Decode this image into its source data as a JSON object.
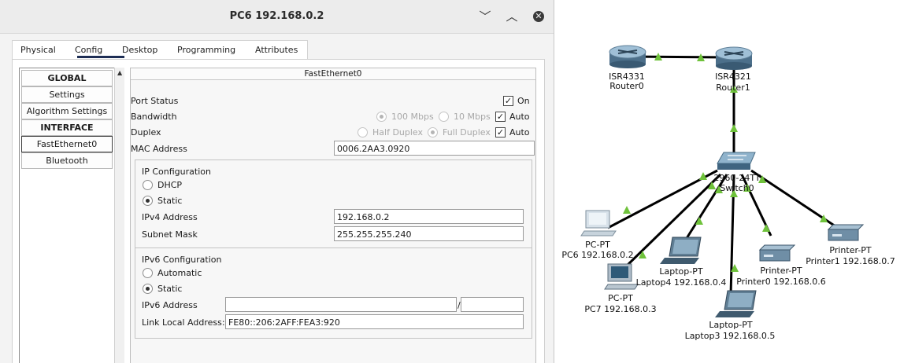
{
  "window": {
    "title": "PC6 192.168.0.2",
    "controls": {
      "minimize": "﹀",
      "maximize": "︿",
      "close": "✕"
    }
  },
  "tabs": [
    {
      "label": "Physical"
    },
    {
      "label": "Config",
      "active": true
    },
    {
      "label": "Desktop"
    },
    {
      "label": "Programming"
    },
    {
      "label": "Attributes"
    }
  ],
  "sidebar": {
    "global_header": "GLOBAL",
    "settings": "Settings",
    "algorithm_settings": "Algorithm Settings",
    "interface_header": "INTERFACE",
    "fastethernet0": "FastEthernet0",
    "bluetooth": "Bluetooth"
  },
  "panel": {
    "title": "FastEthernet0",
    "port_status": {
      "label": "Port Status",
      "on_label": "On",
      "checked": true
    },
    "bandwidth": {
      "label": "Bandwidth",
      "opt_100": "100 Mbps",
      "opt_10": "10 Mbps",
      "auto_label": "Auto",
      "auto": true
    },
    "duplex": {
      "label": "Duplex",
      "half": "Half Duplex",
      "full": "Full Duplex",
      "auto_label": "Auto",
      "auto": true
    },
    "mac": {
      "label": "MAC Address",
      "value": "0006.2AA3.0920"
    },
    "ip_config": {
      "title": "IP Configuration",
      "dhcp": "DHCP",
      "static": "Static",
      "selected": "static",
      "ipv4_label": "IPv4 Address",
      "ipv4_value": "192.168.0.2",
      "mask_label": "Subnet Mask",
      "mask_value": "255.255.255.240"
    },
    "ipv6_config": {
      "title": "IPv6 Configuration",
      "automatic": "Automatic",
      "static": "Static",
      "selected": "static",
      "ipv6_label": "IPv6 Address",
      "ipv6_value": "",
      "prefix_sep": "/",
      "prefix_value": "",
      "link_local_label": "Link Local Address:",
      "link_local_value": "FE80::206:2AFF:FEA3:920"
    }
  },
  "topology": {
    "colors": {
      "link": "#000000",
      "link_status": "#6fc23b"
    },
    "router0": {
      "model": "ISR4331",
      "name": "Router0"
    },
    "router1": {
      "model": "ISR4321",
      "name": "Router1"
    },
    "switch": {
      "model": "2960-24TT",
      "name": "Switch0"
    },
    "pc6": {
      "type": "PC-PT",
      "name": "PC6 192.168.0.2"
    },
    "pc7": {
      "type": "PC-PT",
      "name": "PC7 192.168.0.3"
    },
    "laptop4": {
      "type": "Laptop-PT",
      "name": "Laptop4 192.168.0.4"
    },
    "laptop3": {
      "type": "Laptop-PT",
      "name": "Laptop3 192.168.0.5"
    },
    "printer0": {
      "type": "Printer-PT",
      "name": "Printer0 192.168.0.6"
    },
    "printer1": {
      "type": "Printer-PT",
      "name": "Printer1 192.168.0.7"
    }
  }
}
